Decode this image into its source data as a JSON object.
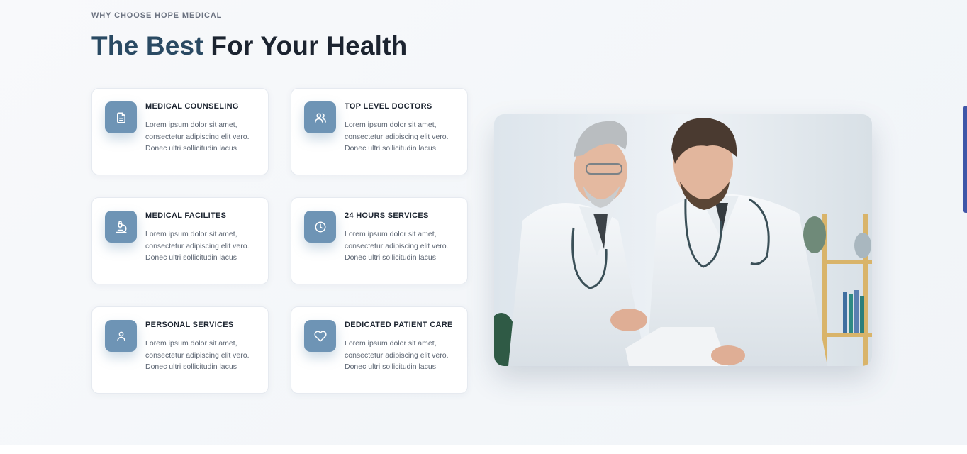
{
  "section": {
    "eyebrow": "WHY CHOOSE HOPE MEDICAL",
    "headline_accent": "The Best",
    "headline_rest": "For Your Health"
  },
  "features": [
    {
      "title": "MEDICAL COUNSELING",
      "line1": "Lorem ipsum dolor sit amet,",
      "line2": "consectetur adipiscing elit vero.",
      "line3": "Donec ultri sollicitudin lacus",
      "icon": "document-icon"
    },
    {
      "title": "TOP LEVEL DOCTORS",
      "line1": "Lorem ipsum dolor sit amet,",
      "line2": "consectetur adipiscing elit vero.",
      "line3": "Donec ultri sollicitudin lacus",
      "icon": "users-icon"
    },
    {
      "title": "MEDICAL FACILITES",
      "line1": "Lorem ipsum dolor sit amet,",
      "line2": "consectetur adipiscing elit vero.",
      "line3": "Donec ultri sollicitudin lacus",
      "icon": "microscope-icon"
    },
    {
      "title": "24 HOURS SERVICES",
      "line1": "Lorem ipsum dolor sit amet,",
      "line2": "consectetur adipiscing elit vero.",
      "line3": "Donec ultri sollicitudin lacus",
      "icon": "clock-icon"
    },
    {
      "title": "PERSONAL SERVICES",
      "line1": "Lorem ipsum dolor sit amet,",
      "line2": "consectetur adipiscing elit vero.",
      "line3": "Donec ultri sollicitudin lacus",
      "icon": "user-icon"
    },
    {
      "title": "DEDICATED PATIENT CARE",
      "line1": "Lorem ipsum dolor sit amet,",
      "line2": "consectetur adipiscing elit vero.",
      "line3": "Donec ultri sollicitudin lacus",
      "icon": "heart-icon"
    }
  ],
  "colors": {
    "icon_bg": "#6e94b5",
    "headline_accent": "#2a4a63",
    "headline_text": "#1c2430",
    "scroll_indicator": "#3f56a8"
  }
}
